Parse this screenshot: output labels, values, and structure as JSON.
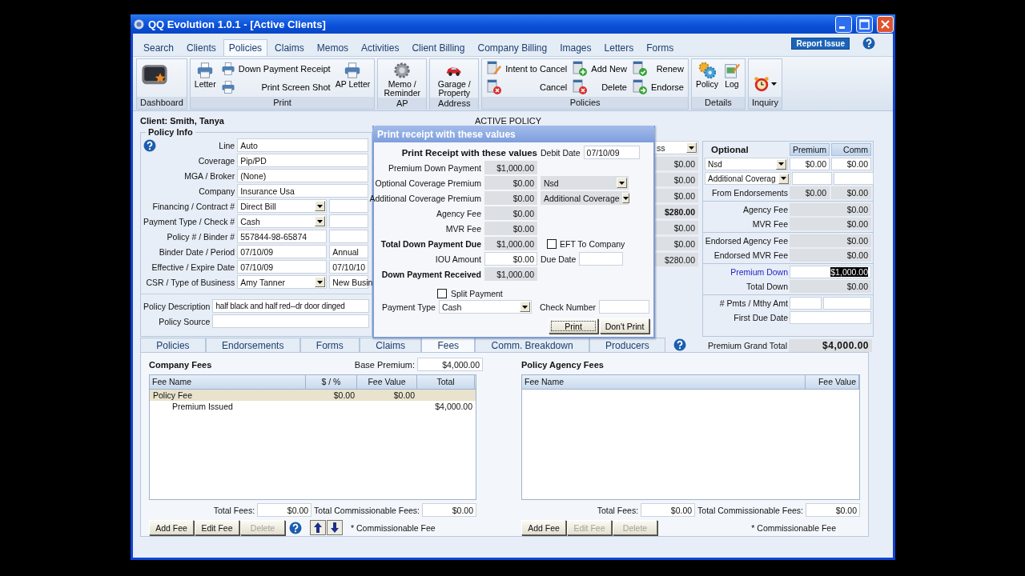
{
  "window": {
    "title": "QQ Evolution 1.0.1 - [Active Clients]"
  },
  "menu": [
    {
      "label": "Search",
      "selected": false
    },
    {
      "label": "Clients",
      "selected": false
    },
    {
      "label": "Policies",
      "selected": true
    },
    {
      "label": "Claims",
      "selected": false
    },
    {
      "label": "Memos",
      "selected": false
    },
    {
      "label": "Activities",
      "selected": false
    },
    {
      "label": "Client Billing",
      "selected": false
    },
    {
      "label": "Company Billing",
      "selected": false
    },
    {
      "label": "Images",
      "selected": false
    },
    {
      "label": "Letters",
      "selected": false
    },
    {
      "label": "Forms",
      "selected": false
    }
  ],
  "report_issue": "Report Issue",
  "ribbon": [
    {
      "label": "Dashboard",
      "items": [
        {
          "kind": "large"
        }
      ]
    },
    {
      "label": "Print",
      "items": [
        {
          "kind": "large",
          "label": "Letter"
        },
        {
          "kind": "stack",
          "items": [
            {
              "label": "Down Payment Receipt"
            },
            {
              "label": "Print Screen Shot"
            }
          ]
        },
        {
          "kind": "large",
          "label": "AP Letter"
        }
      ]
    },
    {
      "label": "AP",
      "items": [
        {
          "kind": "large",
          "label": "Memo / Reminder"
        }
      ]
    },
    {
      "label": "Address",
      "items": [
        {
          "kind": "large",
          "label": "Garage / Property"
        }
      ]
    },
    {
      "label": "Policies",
      "items": [
        {
          "kind": "stack",
          "items": [
            {
              "label": "Intent to Cancel"
            },
            {
              "label": "Cancel"
            }
          ]
        },
        {
          "kind": "stack",
          "items": [
            {
              "label": "Add New"
            },
            {
              "label": "Delete"
            }
          ]
        },
        {
          "kind": "stack",
          "items": [
            {
              "label": "Renew"
            },
            {
              "label": "Endorse"
            }
          ]
        }
      ]
    },
    {
      "label": "Details",
      "items": [
        {
          "kind": "large",
          "label": "Policy"
        },
        {
          "kind": "large",
          "label": "Log"
        }
      ]
    },
    {
      "label": "Inquiry",
      "items": [
        {
          "kind": "menu"
        }
      ]
    }
  ],
  "client": "Client: Smith, Tanya",
  "active_policy": "ACTIVE POLICY",
  "policy_info": {
    "title": "Policy Info",
    "rows": [
      {
        "kind": "full",
        "label": "Line",
        "value": "Auto",
        "dropdown": false
      },
      {
        "kind": "full",
        "label": "Coverage",
        "value": "Pip/PD",
        "dropdown": false
      },
      {
        "kind": "full",
        "label": "MGA / Broker",
        "value": "(None)",
        "dropdown": false
      },
      {
        "kind": "full",
        "label": "Company",
        "value": "Insurance Usa",
        "dropdown": false
      },
      {
        "kind": "split",
        "label": "Financing / Contract #",
        "value": "Direct Bill",
        "dropdown": true
      },
      {
        "kind": "split",
        "label": "Payment Type / Check #",
        "value": "Cash",
        "dropdown": true
      },
      {
        "kind": "split",
        "label": "Policy # / Binder #",
        "value": "557844-98-65874",
        "dropdown": false
      },
      {
        "kind": "split",
        "label": "Binder Date / Period",
        "value": "07/10/09",
        "dropdown": false,
        "second": "Annual"
      },
      {
        "kind": "split",
        "label": "Effective / Expire Date",
        "value": "07/10/09",
        "dropdown": false,
        "second": "07/10/10"
      },
      {
        "kind": "split",
        "label": "CSR / Type of Business",
        "value": "Amy Tanner",
        "dropdown": true,
        "second": "New Busin"
      }
    ],
    "notes": [
      {
        "label": "Policy Description",
        "value": "half black and half red--dr door dinged"
      },
      {
        "label": "Policy Source"
      }
    ]
  },
  "middle_values": [
    {
      "kind": "select",
      "value": "ss",
      "bold": false
    },
    {
      "kind": "field",
      "value": "$0.00",
      "bold": false
    },
    {
      "kind": "field",
      "value": "$0.00",
      "bold": false
    },
    {
      "kind": "field",
      "value": "$0.00",
      "bold": false
    },
    {
      "kind": "field",
      "value": "$280.00",
      "bold": true
    },
    {
      "kind": "field",
      "value": "$0.00",
      "bold": false
    },
    {
      "kind": "field",
      "value": "$0.00",
      "bold": false
    },
    {
      "kind": "field",
      "value": "$280.00",
      "bold": false
    }
  ],
  "optional": {
    "title": "Optional",
    "columns": [
      "Premium",
      "Comm"
    ],
    "sections": [
      [
        {
          "kind": "select",
          "value": "Nsd",
          "premium": "$0.00",
          "comm": "$0.00"
        },
        {
          "kind": "select",
          "value": "Additional Coverag"
        },
        {
          "kind": "pair",
          "label": "From Endorsements",
          "premium": "$0.00",
          "comm": "$0.00"
        }
      ],
      [
        {
          "kind": "wide",
          "label": "Agency Fee",
          "value": "$0.00"
        },
        {
          "kind": "wide",
          "label": "MVR Fee",
          "value": "$0.00"
        }
      ],
      [
        {
          "kind": "wide",
          "label": "Endorsed Agency Fee",
          "value": "$0.00"
        },
        {
          "kind": "wide",
          "label": "Endorsed MVR Fee",
          "value": "$0.00"
        }
      ],
      [
        {
          "kind": "input",
          "label": "Premium Down",
          "value": "$1,000.00",
          "emphasis": true,
          "text_selected": true
        },
        {
          "kind": "wide",
          "label": "Total Down",
          "value": "$0.00"
        }
      ],
      [
        {
          "kind": "pair-input",
          "label": "# Pmts / Mthy Amt"
        },
        {
          "kind": "input",
          "label": "First Due Date"
        }
      ]
    ]
  },
  "premium_grand_total": {
    "label": "Premium Grand Total",
    "value": "$4,000.00"
  },
  "dialog": {
    "title": "Print receipt with these values",
    "heading": "Print Receipt with these values",
    "debit_date": {
      "label": "Debit Date",
      "value": "07/10/09"
    },
    "rows": [
      {
        "label": "Premium Down Payment",
        "value": "$1,000.00",
        "bold": false,
        "editable": false
      },
      {
        "label": "Optional Coverage Premium",
        "value": "$0.00",
        "bold": false,
        "editable": false,
        "extra": {
          "kind": "select",
          "value": "Nsd"
        }
      },
      {
        "label": "Additional Coverage Premium",
        "value": "$0.00",
        "bold": false,
        "editable": false,
        "extra": {
          "kind": "select",
          "value": "Additional Coverage"
        }
      },
      {
        "label": "Agency Fee",
        "value": "$0.00",
        "bold": false,
        "editable": false
      },
      {
        "label": "MVR Fee",
        "value": "$0.00",
        "bold": false,
        "editable": false
      },
      {
        "label": "Total Down Payment Due",
        "value": "$1,000.00",
        "bold": true,
        "editable": false,
        "extra": {
          "kind": "checkbox",
          "label": "EFT To Company",
          "checked": false
        }
      },
      {
        "label": "IOU Amount",
        "value": "$0.00",
        "bold": false,
        "editable": true,
        "extra": {
          "kind": "field",
          "label": "Due Date"
        }
      },
      {
        "label": "Down Payment Received",
        "value": "$1,000.00",
        "bold": true,
        "editable": false
      }
    ],
    "split_payment": {
      "label": "Split Payment",
      "checked": false
    },
    "payment_type": {
      "label": "Payment Type",
      "value": "Cash"
    },
    "check_number": {
      "label": "Check Number"
    },
    "buttons": [
      {
        "label": "Print",
        "focused": true
      },
      {
        "label": "Don't Print",
        "focused": false
      }
    ]
  },
  "detail_tabs": [
    {
      "label": "Policies",
      "selected": false
    },
    {
      "label": "Endorsements",
      "selected": false
    },
    {
      "label": "Forms",
      "selected": false
    },
    {
      "label": "Claims",
      "selected": false
    },
    {
      "label": "Fees",
      "selected": true
    },
    {
      "label": "Comm. Breakdown",
      "selected": false
    },
    {
      "label": "Producers",
      "selected": false
    }
  ],
  "company_fees": {
    "title": "Company Fees",
    "base_premium": {
      "label": "Base Premium:",
      "value": "$4,000.00"
    },
    "columns": [
      "Fee Name",
      "$ / %",
      "Fee Value",
      "Total"
    ],
    "rows": [
      {
        "name": "Policy Fee",
        "rate": "$0.00",
        "fee_value": "$0.00",
        "selected": true,
        "children": [
          {
            "name": "Premium Issued",
            "total": "$4,000.00",
            "selected": false
          }
        ]
      }
    ],
    "totals": [
      {
        "label": "Total Fees:",
        "value": "$0.00"
      },
      {
        "label": "Total Commissionable Fees:",
        "value": "$0.00"
      }
    ],
    "buttons": [
      {
        "label": "Add Fee",
        "disabled": false
      },
      {
        "label": "Edit Fee",
        "disabled": false
      },
      {
        "label": "Delete",
        "disabled": true
      }
    ],
    "reorder": true,
    "note": "* Commissionable Fee"
  },
  "agency_fees": {
    "title": "Policy Agency Fees",
    "columns": [
      "Fee Name",
      "Fee Value"
    ],
    "totals": [
      {
        "label": "Total Fees:",
        "value": "$0.00"
      },
      {
        "label": "Total Commissionable Fees:",
        "value": "$0.00"
      }
    ],
    "buttons": [
      {
        "label": "Add Fee",
        "disabled": false
      },
      {
        "label": "Edit Fee",
        "disabled": true
      },
      {
        "label": "Delete",
        "disabled": true
      }
    ],
    "reorder": false,
    "note": "* Commissionable Fee"
  }
}
